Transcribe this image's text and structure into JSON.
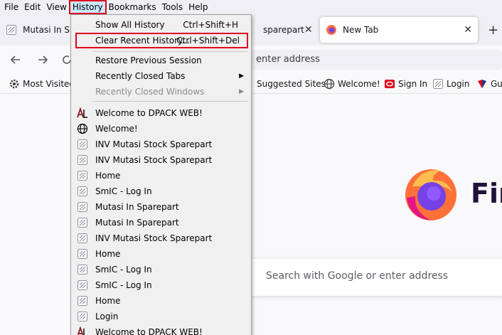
{
  "menubar": {
    "items": [
      "File",
      "Edit",
      "View",
      "History",
      "Bookmarks",
      "Tools",
      "Help"
    ],
    "active": "History"
  },
  "tabs": {
    "bg_tab_label": "Mutasi In Spa",
    "bg_tab2_label": "sparepart",
    "active_tab_label": "New Tab",
    "close_glyph": "✕",
    "new_tab_glyph": "+"
  },
  "navbar": {
    "url_placeholder": "enter address",
    "back_icon": "arrow-left-icon",
    "forward_icon": "arrow-right-icon",
    "reload_icon": "reload-icon"
  },
  "bookmarks": {
    "items": [
      "Most Visited",
      "Suggested Sites",
      "Welcome!",
      "Sign In",
      "Login",
      "Gu"
    ]
  },
  "history_menu": {
    "show_all": {
      "label": "Show All History",
      "shortcut": "Ctrl+Shift+H"
    },
    "clear_recent": {
      "label": "Clear Recent History...",
      "shortcut": "Ctrl+Shift+Del"
    },
    "restore": {
      "label": "Restore Previous Session"
    },
    "recently_closed_tabs": {
      "label": "Recently Closed Tabs",
      "arrow": "▶"
    },
    "recently_closed_windows": {
      "label": "Recently Closed Windows",
      "arrow": "▶"
    },
    "entries": [
      {
        "label": "Welcome to DPACK WEB!",
        "icon": "dpack-icon"
      },
      {
        "label": "Welcome!",
        "icon": "globe-icon"
      },
      {
        "label": "INV Mutasi Stock Sparepart",
        "icon": "generic-page-icon"
      },
      {
        "label": "INV Mutasi Stock Sparepart",
        "icon": "generic-page-icon"
      },
      {
        "label": "Home",
        "icon": "generic-page-icon"
      },
      {
        "label": "SmIC - Log In",
        "icon": "generic-page-icon"
      },
      {
        "label": "Mutasi In Sparepart",
        "icon": "generic-page-icon"
      },
      {
        "label": "Mutasi In Sparepart",
        "icon": "generic-page-icon"
      },
      {
        "label": "INV Mutasi Stock Sparepart",
        "icon": "generic-page-icon"
      },
      {
        "label": "Home",
        "icon": "generic-page-icon"
      },
      {
        "label": "SmIC - Log In",
        "icon": "generic-page-icon"
      },
      {
        "label": "SmIC - Log In",
        "icon": "generic-page-icon"
      },
      {
        "label": "Home",
        "icon": "generic-page-icon"
      },
      {
        "label": "Login",
        "icon": "generic-page-icon"
      },
      {
        "label": "Welcome to DPACK WEB!",
        "icon": "dpack-icon"
      }
    ]
  },
  "content": {
    "brand_word": "Fir",
    "search_placeholder": "Search with Google or enter address"
  },
  "colors": {
    "highlight_outline": "#e0001a",
    "menu_bg": "#f0f0f0",
    "firefox_orange": "#ff7139",
    "firefox_purple": "#7542e5"
  }
}
